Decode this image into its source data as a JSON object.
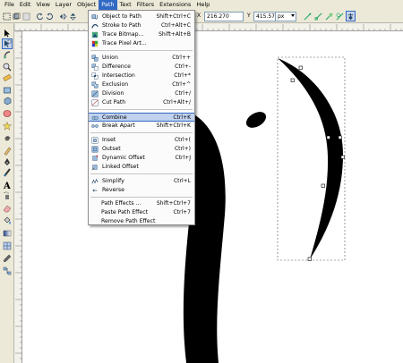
{
  "menubar": {
    "items": [
      "File",
      "Edit",
      "View",
      "Layer",
      "Object",
      "Path",
      "Text",
      "Filters",
      "Extensions",
      "Help"
    ],
    "active": "Path"
  },
  "toolbar": {
    "x_label": "X",
    "x_value": "216.270",
    "y_label": "Y",
    "y_value": "415.575",
    "unit": "px"
  },
  "path_menu": {
    "object_to_path": {
      "label": "Object to Path",
      "shortcut": "Shift+Ctrl+C",
      "icon": "object-to-path-icon"
    },
    "stroke_to_path": {
      "label": "Stroke to Path",
      "shortcut": "Ctrl+Alt+C",
      "icon": "stroke-to-path-icon"
    },
    "trace_bitmap": {
      "label": "Trace Bitmap...",
      "shortcut": "Shift+Alt+B",
      "icon": "trace-bitmap-icon"
    },
    "trace_pixel_art": {
      "label": "Trace Pixel Art...",
      "shortcut": "",
      "icon": "trace-pixel-art-icon"
    },
    "union": {
      "label": "Union",
      "shortcut": "Ctrl++",
      "icon": "union-icon"
    },
    "difference": {
      "label": "Difference",
      "shortcut": "Ctrl+-",
      "icon": "difference-icon"
    },
    "intersection": {
      "label": "Intersection",
      "shortcut": "Ctrl+*",
      "icon": "intersection-icon"
    },
    "exclusion": {
      "label": "Exclusion",
      "shortcut": "Ctrl+^",
      "icon": "exclusion-icon"
    },
    "division": {
      "label": "Division",
      "shortcut": "Ctrl+/",
      "icon": "division-icon"
    },
    "cut_path": {
      "label": "Cut Path",
      "shortcut": "Ctrl+Alt+/",
      "icon": "cut-path-icon"
    },
    "combine": {
      "label": "Combine",
      "shortcut": "Ctrl+K",
      "icon": "combine-icon"
    },
    "break_apart": {
      "label": "Break Apart",
      "shortcut": "Shift+Ctrl+K",
      "icon": "break-apart-icon"
    },
    "inset": {
      "label": "Inset",
      "shortcut": "Ctrl+(",
      "icon": "inset-icon"
    },
    "outset": {
      "label": "Outset",
      "shortcut": "Ctrl+)",
      "icon": "outset-icon"
    },
    "dynamic_offset": {
      "label": "Dynamic Offset",
      "shortcut": "Ctrl+J",
      "icon": "dynamic-offset-icon"
    },
    "linked_offset": {
      "label": "Linked Offset",
      "shortcut": "",
      "icon": "linked-offset-icon"
    },
    "simplify": {
      "label": "Simplify",
      "shortcut": "Ctrl+L",
      "icon": "simplify-icon"
    },
    "reverse": {
      "label": "Reverse",
      "shortcut": "",
      "icon": "reverse-icon"
    },
    "path_effects": {
      "label": "Path Effects ...",
      "shortcut": "Shift+Ctrl+7"
    },
    "paste_path_effect": {
      "label": "Paste Path Effect",
      "shortcut": "Ctrl+7"
    },
    "remove_path_effect": {
      "label": "Remove Path Effect",
      "shortcut": ""
    },
    "hovered": "Combine"
  },
  "colors": {
    "chrome": "#ece9d8",
    "highlight": "#316ac5",
    "hover": "#c1d2ee",
    "shape": "#000000"
  }
}
